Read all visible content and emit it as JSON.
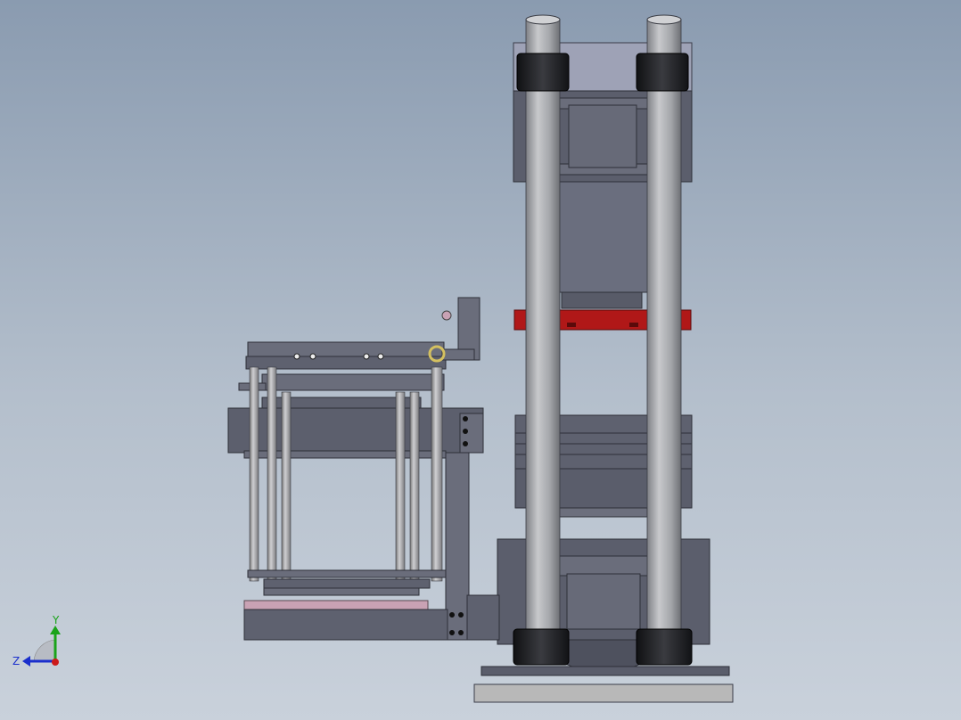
{
  "triad": {
    "y_label": "Y",
    "z_label": "Z",
    "y_color": "#1aa31a",
    "z_color": "#1a2fcc",
    "x_color": "#cc1a1a"
  },
  "colors": {
    "steel": "#5c5f6c",
    "steel_dark": "#3e404a",
    "rod": "#a6a8ac",
    "nut": "#1e1f22",
    "red_plate": "#b01818",
    "pink_plate": "#c9a2b4",
    "base": "#b8b8b8"
  }
}
